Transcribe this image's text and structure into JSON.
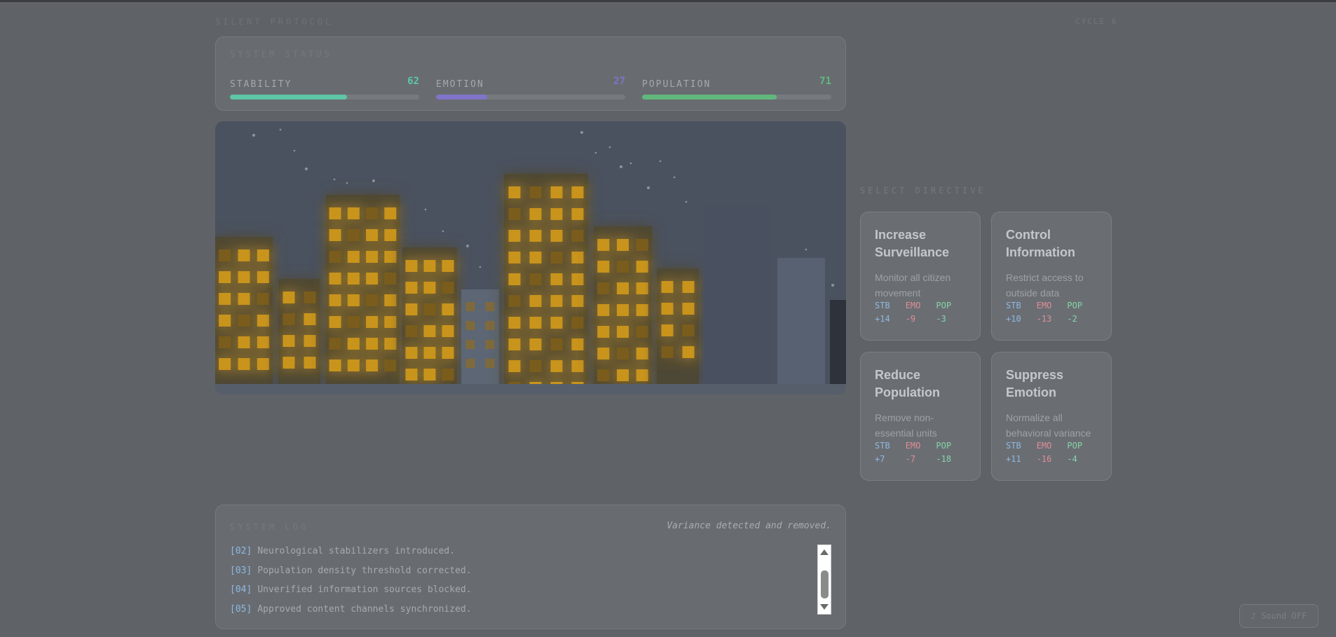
{
  "header": {
    "app_title": "SILENT PROTOCOL",
    "cycle": "CYCLE 6"
  },
  "status": {
    "label": "SYSTEM STATUS",
    "stats": [
      {
        "name": "STABILITY",
        "value": 62,
        "color": "#5dc7a5"
      },
      {
        "name": "EMOTION",
        "value": 27,
        "color": "#7f74c9"
      },
      {
        "name": "POPULATION",
        "value": 71,
        "color": "#61b87c"
      }
    ]
  },
  "directive": {
    "label": "SELECT DIRECTIVE",
    "cards": [
      {
        "title": "Increase Surveillance",
        "desc": "Monitor all citizen movement",
        "stb_label": "STB",
        "stb": "+14",
        "emo_label": "EMO",
        "emo": "-9",
        "pop_label": "POP",
        "pop": "-3"
      },
      {
        "title": "Control Information",
        "desc": "Restrict access to outside data",
        "stb_label": "STB",
        "stb": "+10",
        "emo_label": "EMO",
        "emo": "-13",
        "pop_label": "POP",
        "pop": "-2"
      },
      {
        "title": "Reduce Population",
        "desc": "Remove non-essential units",
        "stb_label": "STB",
        "stb": "+7",
        "emo_label": "EMO",
        "emo": "-7",
        "pop_label": "POP",
        "pop": "-18"
      },
      {
        "title": "Suppress Emotion",
        "desc": "Normalize all behavioral variance",
        "stb_label": "STB",
        "stb": "+11",
        "emo_label": "EMO",
        "emo": "-16",
        "pop_label": "POP",
        "pop": "-4"
      }
    ]
  },
  "log": {
    "label": "SYSTEM LOG",
    "note": "Variance detected and removed.",
    "entries": [
      {
        "id": "[02]",
        "text": "Neurological stabilizers introduced."
      },
      {
        "id": "[03]",
        "text": "Population density threshold corrected."
      },
      {
        "id": "[04]",
        "text": "Unverified information sources blocked."
      },
      {
        "id": "[05]",
        "text": "Approved content channels synchronized."
      }
    ]
  },
  "sound_button": "♪ Sound OFF",
  "colors": {
    "window_lit": "#c9941f",
    "window_dim": "#7a5d1c",
    "sky": "#4a5260"
  }
}
